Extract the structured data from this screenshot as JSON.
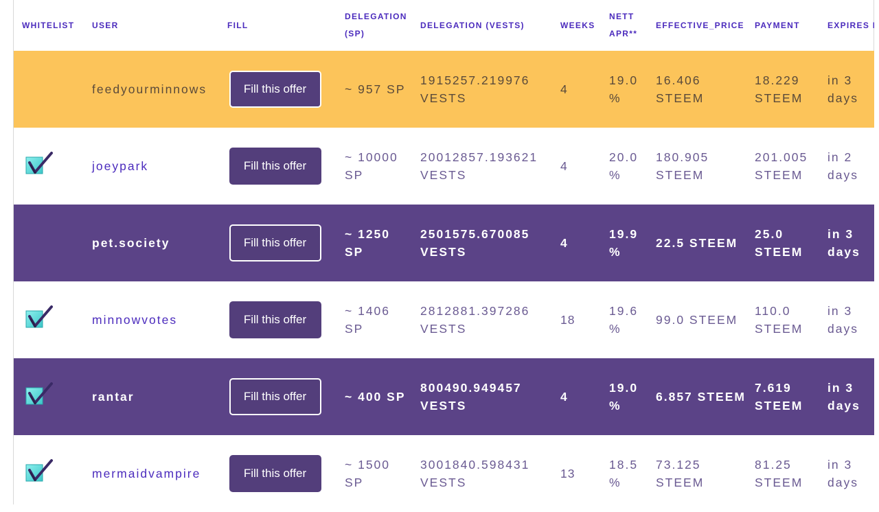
{
  "headers": {
    "whitelist": "WHITELIST",
    "user": "USER",
    "fill": "FILL",
    "delegation_sp": "DELEGATION (SP)",
    "delegation_vests": "DELEGATION (VESTS)",
    "weeks": "WEEKS",
    "nett_apr": "NETT APR**",
    "effective_price": "EFFECTIVE_PRICE",
    "payment": "PAYMENT",
    "expires": "EXPIRES IN"
  },
  "fill_label": "Fill this offer",
  "colors": {
    "header_text": "#4b2bbd",
    "row_gold": "#fcc45a",
    "row_purple": "#5b4387",
    "button": "#533e7b",
    "check_teal": "#5ad6d6"
  },
  "rows": [
    {
      "whitelisted": false,
      "style": "gold",
      "user": "feedyourminnows",
      "sp": "~ 957 SP",
      "vests": "1915257.219976 VESTS",
      "weeks": "4",
      "apr": "19.0 %",
      "price": "16.406 STEEM",
      "payment": "18.229 STEEM",
      "expires": "in 3 days"
    },
    {
      "whitelisted": true,
      "check_icon": "checkbox-checked-icon",
      "style": "white",
      "user": "joeypark",
      "sp": "~ 10000 SP",
      "vests": "20012857.193621 VESTS",
      "weeks": "4",
      "apr": "20.0 %",
      "price": "180.905 STEEM",
      "payment": "201.005 STEEM",
      "expires": "in 2 days"
    },
    {
      "whitelisted": false,
      "style": "purple",
      "user": "pet.society",
      "sp": "~ 1250 SP",
      "vests": "2501575.670085 VESTS",
      "weeks": "4",
      "apr": "19.9 %",
      "price": "22.5 STEEM",
      "payment": "25.0 STEEM",
      "expires": "in 3 days"
    },
    {
      "whitelisted": true,
      "check_icon": "checkbox-checked-icon",
      "style": "white",
      "user": "minnowvotes",
      "sp": "~ 1406 SP",
      "vests": "2812881.397286 VESTS",
      "weeks": "18",
      "apr": "19.6 %",
      "price": "99.0 STEEM",
      "payment": "110.0 STEEM",
      "expires": "in 3 days"
    },
    {
      "whitelisted": true,
      "check_icon": "checkbox-checked-icon",
      "style": "purple",
      "user": "rantar",
      "sp": "~ 400 SP",
      "vests": "800490.949457 VESTS",
      "weeks": "4",
      "apr": "19.0 %",
      "price": "6.857 STEEM",
      "payment": "7.619 STEEM",
      "expires": "in 3 days"
    },
    {
      "whitelisted": true,
      "check_icon": "checkbox-checked-icon",
      "style": "white",
      "user": "mermaidvampire",
      "sp": "~ 1500 SP",
      "vests": "3001840.598431 VESTS",
      "weeks": "13",
      "apr": "18.5 %",
      "price": "73.125 STEEM",
      "payment": "81.25 STEEM",
      "expires": "in 3 days"
    }
  ]
}
